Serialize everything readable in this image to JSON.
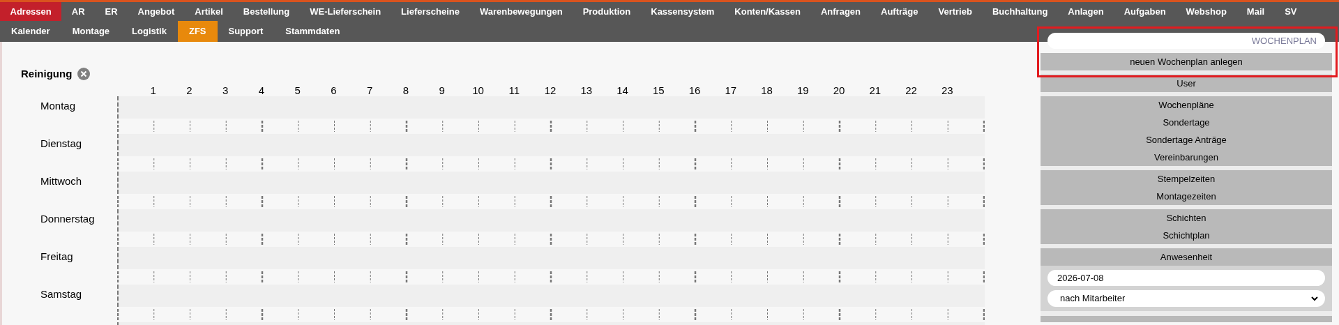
{
  "top_menu": [
    {
      "label": "Adressen",
      "selected": true
    },
    {
      "label": "AR",
      "selected": false
    },
    {
      "label": "ER",
      "selected": false
    },
    {
      "label": "Angebot",
      "selected": false
    },
    {
      "label": "Artikel",
      "selected": false
    },
    {
      "label": "Bestellung",
      "selected": false
    },
    {
      "label": "WE-Lieferschein",
      "selected": false
    },
    {
      "label": "Lieferscheine",
      "selected": false
    },
    {
      "label": "Warenbewegungen",
      "selected": false
    },
    {
      "label": "Produktion",
      "selected": false
    },
    {
      "label": "Kassensystem",
      "selected": false
    },
    {
      "label": "Konten/Kassen",
      "selected": false
    },
    {
      "label": "Anfragen",
      "selected": false
    },
    {
      "label": "Aufträge",
      "selected": false
    },
    {
      "label": "Vertrieb",
      "selected": false
    },
    {
      "label": "Buchhaltung",
      "selected": false
    },
    {
      "label": "Anlagen",
      "selected": false
    },
    {
      "label": "Aufgaben",
      "selected": false
    },
    {
      "label": "Webshop",
      "selected": false
    },
    {
      "label": "Mail",
      "selected": false
    },
    {
      "label": "SV",
      "selected": false
    }
  ],
  "sub_menu": [
    {
      "label": "Kalender",
      "selected": false
    },
    {
      "label": "Montage",
      "selected": false
    },
    {
      "label": "Logistik",
      "selected": false
    },
    {
      "label": "ZFS",
      "selected": true
    },
    {
      "label": "Support",
      "selected": false
    },
    {
      "label": "Stammdaten",
      "selected": false
    }
  ],
  "plan": {
    "title": "Reinigung",
    "hours": [
      "1",
      "2",
      "3",
      "4",
      "5",
      "6",
      "7",
      "8",
      "9",
      "10",
      "11",
      "12",
      "13",
      "14",
      "15",
      "16",
      "17",
      "18",
      "19",
      "20",
      "21",
      "22",
      "23"
    ],
    "days": [
      {
        "name": "Montag"
      },
      {
        "name": "Dienstag"
      },
      {
        "name": "Mittwoch"
      },
      {
        "name": "Donnerstag"
      },
      {
        "name": "Freitag"
      },
      {
        "name": "Samstag"
      }
    ]
  },
  "sidebar": {
    "search": {
      "placeholder": "WOCHENPLAN",
      "highlighted": true
    },
    "create_button": "neuen Wochenplan anlegen",
    "sections": [
      {
        "items": [
          "User"
        ]
      },
      {
        "items": [
          "Wochenpläne",
          "Sondertage",
          "Sondertage Anträge",
          "Vereinbarungen"
        ]
      },
      {
        "items": [
          "Stempelzeiten",
          "Montagezeiten"
        ]
      },
      {
        "items": [
          "Schichten",
          "Schichtplan"
        ]
      },
      {
        "items": [
          "Anwesenheit"
        ],
        "date": "2026-07-08",
        "filter": "nach Mitarbeiter"
      }
    ]
  }
}
